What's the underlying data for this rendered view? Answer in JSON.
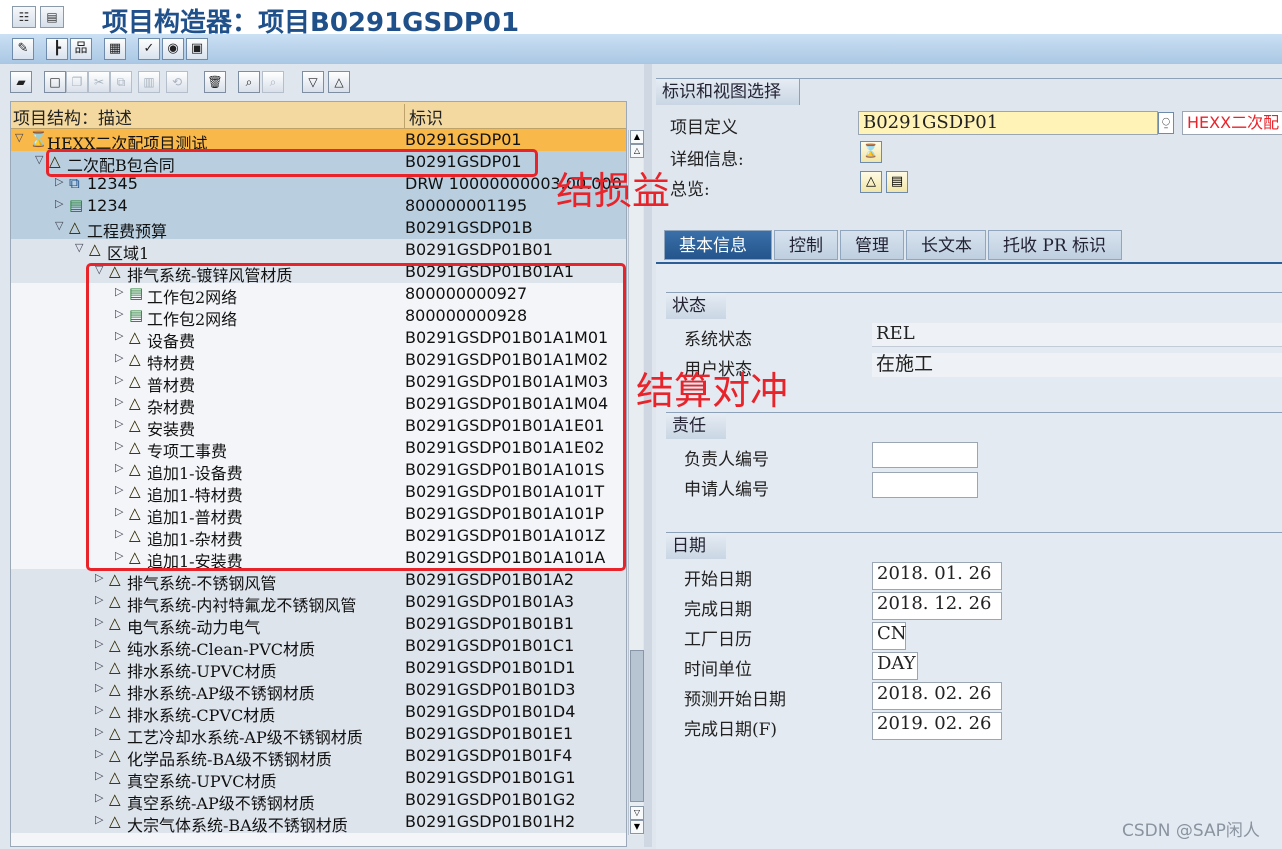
{
  "window": {
    "title": "项目构造器：项目B0291GSDP01"
  },
  "tree": {
    "col_desc": "项目结构：描述",
    "col_id": "标识",
    "rows": [
      {
        "exp": "▽",
        "icon": "hourglass",
        "label": "HEXX二次配项目测试",
        "id": "B0291GSDP01",
        "level": 0,
        "style": "orange"
      },
      {
        "exp": "▽",
        "icon": "triangle",
        "label": "二次配B包合同",
        "id": "B0291GSDP01",
        "level": 1,
        "style": "blue"
      },
      {
        "exp": "▷",
        "icon": "network",
        "label": "12345",
        "id": "DRW 10000000003.00.000",
        "level": 2,
        "style": "blue"
      },
      {
        "exp": "▷",
        "icon": "green",
        "label": "1234",
        "id": "800000001195",
        "level": 2,
        "style": "blue"
      },
      {
        "exp": "▽",
        "icon": "triangle",
        "label": "工程费预算",
        "id": "B0291GSDP01B",
        "level": 2,
        "style": "blue"
      },
      {
        "exp": "▽",
        "icon": "triangle",
        "label": "区域1",
        "id": "B0291GSDP01B01",
        "level": 3,
        "style": "light"
      },
      {
        "exp": "▽",
        "icon": "triangle",
        "label": "排气系统-镀锌风管材质",
        "id": "B0291GSDP01B01A1",
        "level": 4,
        "style": "light"
      },
      {
        "exp": "▷",
        "icon": "green",
        "label": "工作包2网络",
        "id": "800000000927",
        "level": 5,
        "style": "white"
      },
      {
        "exp": "▷",
        "icon": "green",
        "label": "工作包2网络",
        "id": "800000000928",
        "level": 5,
        "style": "white"
      },
      {
        "exp": "▷",
        "icon": "triangle",
        "label": "设备费",
        "id": "B0291GSDP01B01A1M01",
        "level": 5,
        "style": "white"
      },
      {
        "exp": "▷",
        "icon": "triangle",
        "label": "特材费",
        "id": "B0291GSDP01B01A1M02",
        "level": 5,
        "style": "white"
      },
      {
        "exp": "▷",
        "icon": "triangle",
        "label": "普材费",
        "id": "B0291GSDP01B01A1M03",
        "level": 5,
        "style": "white"
      },
      {
        "exp": "▷",
        "icon": "triangle",
        "label": "杂材费",
        "id": "B0291GSDP01B01A1M04",
        "level": 5,
        "style": "white"
      },
      {
        "exp": "▷",
        "icon": "triangle",
        "label": "安装费",
        "id": "B0291GSDP01B01A1E01",
        "level": 5,
        "style": "white"
      },
      {
        "exp": "▷",
        "icon": "triangle",
        "label": "专项工事费",
        "id": "B0291GSDP01B01A1E02",
        "level": 5,
        "style": "white"
      },
      {
        "exp": "▷",
        "icon": "triangle",
        "label": "追加1-设备费",
        "id": "B0291GSDP01B01A101S",
        "level": 5,
        "style": "white"
      },
      {
        "exp": "▷",
        "icon": "triangle",
        "label": "追加1-特材费",
        "id": "B0291GSDP01B01A101T",
        "level": 5,
        "style": "white"
      },
      {
        "exp": "▷",
        "icon": "triangle",
        "label": "追加1-普材费",
        "id": "B0291GSDP01B01A101P",
        "level": 5,
        "style": "white"
      },
      {
        "exp": "▷",
        "icon": "triangle",
        "label": "追加1-杂材费",
        "id": "B0291GSDP01B01A101Z",
        "level": 5,
        "style": "white"
      },
      {
        "exp": "▷",
        "icon": "triangle",
        "label": "追加1-安装费",
        "id": "B0291GSDP01B01A101A",
        "level": 5,
        "style": "white"
      },
      {
        "exp": "▷",
        "icon": "triangle",
        "label": "排气系统-不锈钢风管",
        "id": "B0291GSDP01B01A2",
        "level": 4,
        "style": "light"
      },
      {
        "exp": "▷",
        "icon": "triangle",
        "label": "排气系统-内衬特氟龙不锈钢风管",
        "id": "B0291GSDP01B01A3",
        "level": 4,
        "style": "light"
      },
      {
        "exp": "▷",
        "icon": "triangle",
        "label": "电气系统-动力电气",
        "id": "B0291GSDP01B01B1",
        "level": 4,
        "style": "light"
      },
      {
        "exp": "▷",
        "icon": "triangle",
        "label": "纯水系统-Clean-PVC材质",
        "id": "B0291GSDP01B01C1",
        "level": 4,
        "style": "light"
      },
      {
        "exp": "▷",
        "icon": "triangle",
        "label": "排水系统-UPVC材质",
        "id": "B0291GSDP01B01D1",
        "level": 4,
        "style": "light"
      },
      {
        "exp": "▷",
        "icon": "triangle",
        "label": "排水系统-AP级不锈钢材质",
        "id": "B0291GSDP01B01D3",
        "level": 4,
        "style": "light"
      },
      {
        "exp": "▷",
        "icon": "triangle",
        "label": "排水系统-CPVC材质",
        "id": "B0291GSDP01B01D4",
        "level": 4,
        "style": "light"
      },
      {
        "exp": "▷",
        "icon": "triangle",
        "label": "工艺冷却水系统-AP级不锈钢材质",
        "id": "B0291GSDP01B01E1",
        "level": 4,
        "style": "light"
      },
      {
        "exp": "▷",
        "icon": "triangle",
        "label": "化学品系统-BA级不锈钢材质",
        "id": "B0291GSDP01B01F4",
        "level": 4,
        "style": "light"
      },
      {
        "exp": "▷",
        "icon": "triangle",
        "label": "真空系统-UPVC材质",
        "id": "B0291GSDP01B01G1",
        "level": 4,
        "style": "light"
      },
      {
        "exp": "▷",
        "icon": "triangle",
        "label": "真空系统-AP级不锈钢材质",
        "id": "B0291GSDP01B01G2",
        "level": 4,
        "style": "light"
      },
      {
        "exp": "▷",
        "icon": "triangle",
        "label": "大宗气体系统-BA级不锈钢材质",
        "id": "B0291GSDP01B01H2",
        "level": 4,
        "style": "light"
      }
    ]
  },
  "detail": {
    "group_title": "标识和视图选择",
    "project_def_label": "项目定义",
    "project_def_value": "B0291GSDP01",
    "project_def_desc": "HEXX二次配",
    "details_label": "详细信息:",
    "overview_label": "总览:",
    "tabs": [
      "基本信息",
      "控制",
      "管理",
      "长文本",
      "托收 PR 标识"
    ],
    "status_title": "状态",
    "system_status_label": "系统状态",
    "system_status_value": "REL",
    "user_status_label": "用户状态",
    "user_status_value": "在施工",
    "resp_title": "责任",
    "resp_person_label": "负责人编号",
    "applicant_label": "申请人编号",
    "date_title": "日期",
    "start_date_label": "开始日期",
    "start_date_value": "2018. 01. 26",
    "finish_date_label": "完成日期",
    "finish_date_value": "2018. 12. 26",
    "factory_cal_label": "工厂日历",
    "factory_cal_value": "CN",
    "time_unit_label": "时间单位",
    "time_unit_value": "DAY",
    "fc_start_label": "预测开始日期",
    "fc_start_value": "2018. 02. 26",
    "fc_finish_label": "完成日期(F)",
    "fc_finish_value": "2019. 02. 26"
  },
  "annotations": {
    "profit_loss": "结损益",
    "settlement_offset": "结算对冲"
  },
  "watermark": "CSDN @SAP闲人",
  "colors": {
    "red_annotation": "#e8232a",
    "row_orange": "#f8b84a",
    "row_blue": "#b9cfdf",
    "row_light": "#dde4ec",
    "row_white": "#f3f5f8"
  }
}
